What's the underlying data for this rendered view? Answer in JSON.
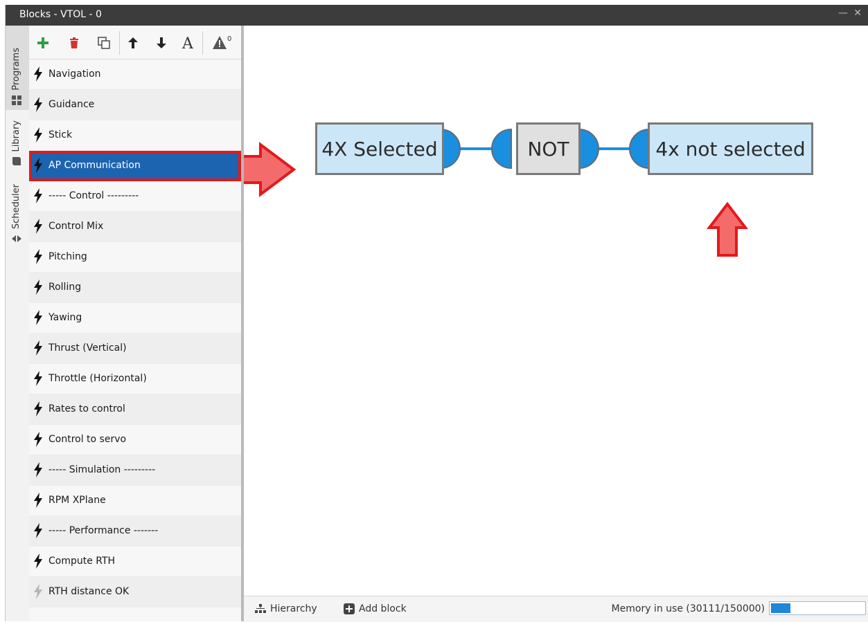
{
  "window": {
    "title": "Blocks - VTOL - 0",
    "controls": "— ✕"
  },
  "side_tabs": [
    {
      "label": "Programs",
      "icon": "grid-icon",
      "active": true
    },
    {
      "label": "Library",
      "icon": "book-icon",
      "active": false
    },
    {
      "label": "Scheduler",
      "icon": "arrows-icon",
      "active": false
    }
  ],
  "toolbar": {
    "buttons": [
      "add-icon",
      "delete-icon",
      "duplicate-icon",
      "move-up-icon",
      "move-down-icon",
      "rename-icon",
      "warning-icon"
    ],
    "warning_count": "0"
  },
  "blocks": [
    {
      "label": "Navigation",
      "enabled": true
    },
    {
      "label": "Guidance",
      "enabled": true
    },
    {
      "label": "Stick",
      "enabled": true
    },
    {
      "label": "AP Communication",
      "enabled": true,
      "selected": true
    },
    {
      "label": "----- Control ---------",
      "enabled": true
    },
    {
      "label": "Control Mix",
      "enabled": true
    },
    {
      "label": "Pitching",
      "enabled": true
    },
    {
      "label": "Rolling",
      "enabled": true
    },
    {
      "label": "Yawing",
      "enabled": true
    },
    {
      "label": "Thrust (Vertical)",
      "enabled": true
    },
    {
      "label": "Throttle (Horizontal)",
      "enabled": true
    },
    {
      "label": "Rates to control",
      "enabled": true
    },
    {
      "label": "Control to servo",
      "enabled": true
    },
    {
      "label": "----- Simulation ---------",
      "enabled": true
    },
    {
      "label": "RPM XPlane",
      "enabled": true
    },
    {
      "label": "----- Performance -------",
      "enabled": true
    },
    {
      "label": "Compute RTH",
      "enabled": true
    },
    {
      "label": "RTH distance OK",
      "enabled": false
    }
  ],
  "diagram": {
    "nodes": [
      {
        "label": "4X Selected",
        "style": "blue"
      },
      {
        "label": "NOT",
        "style": "grey"
      },
      {
        "label": "4x not selected",
        "style": "blue"
      }
    ]
  },
  "bottombar": {
    "hierarchy": "Hierarchy",
    "add_block": "Add block",
    "memory_label": "Memory in use (30111/150000)",
    "memory_fraction": 0.2
  },
  "colors": {
    "selection": "#1c64b0",
    "annotation": "#e3191c",
    "connector": "#1a8fe0"
  }
}
